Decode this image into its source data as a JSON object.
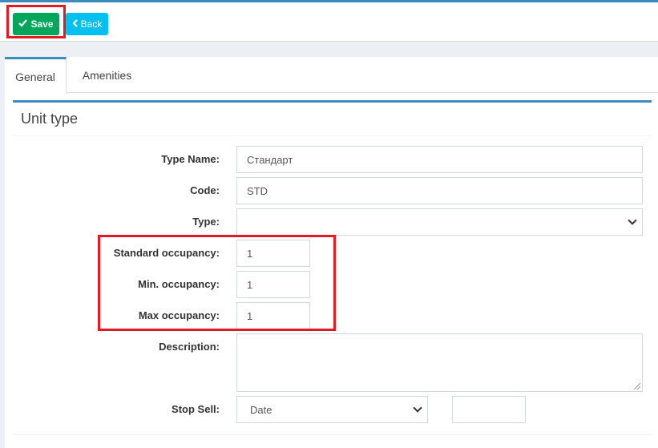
{
  "toolbar": {
    "save_label": "Save",
    "back_label": "Back"
  },
  "tabs": [
    {
      "label": "General"
    },
    {
      "label": "Amenities"
    }
  ],
  "section": {
    "title": "Unit type"
  },
  "form": {
    "type_name": {
      "label": "Type Name:",
      "value": "Стандарт"
    },
    "code": {
      "label": "Code:",
      "value": "STD"
    },
    "type": {
      "label": "Type:",
      "value": ""
    },
    "standard_occupancy": {
      "label": "Standard occupancy:",
      "value": "1"
    },
    "min_occupancy": {
      "label": "Min. occupancy:",
      "value": "1"
    },
    "max_occupancy": {
      "label": "Max occupancy:",
      "value": "1"
    },
    "description": {
      "label": "Description:",
      "value": ""
    },
    "stop_sell": {
      "label": "Stop Sell:",
      "select_value": "Date",
      "input_value": ""
    }
  },
  "colors": {
    "accent": "#3c8dbc",
    "save": "#00a65a",
    "back": "#00c0ef",
    "highlight": "#e01b24"
  },
  "icons": {
    "save": "check-icon",
    "back": "chevron-left-icon",
    "select": "chevron-down-icon"
  }
}
